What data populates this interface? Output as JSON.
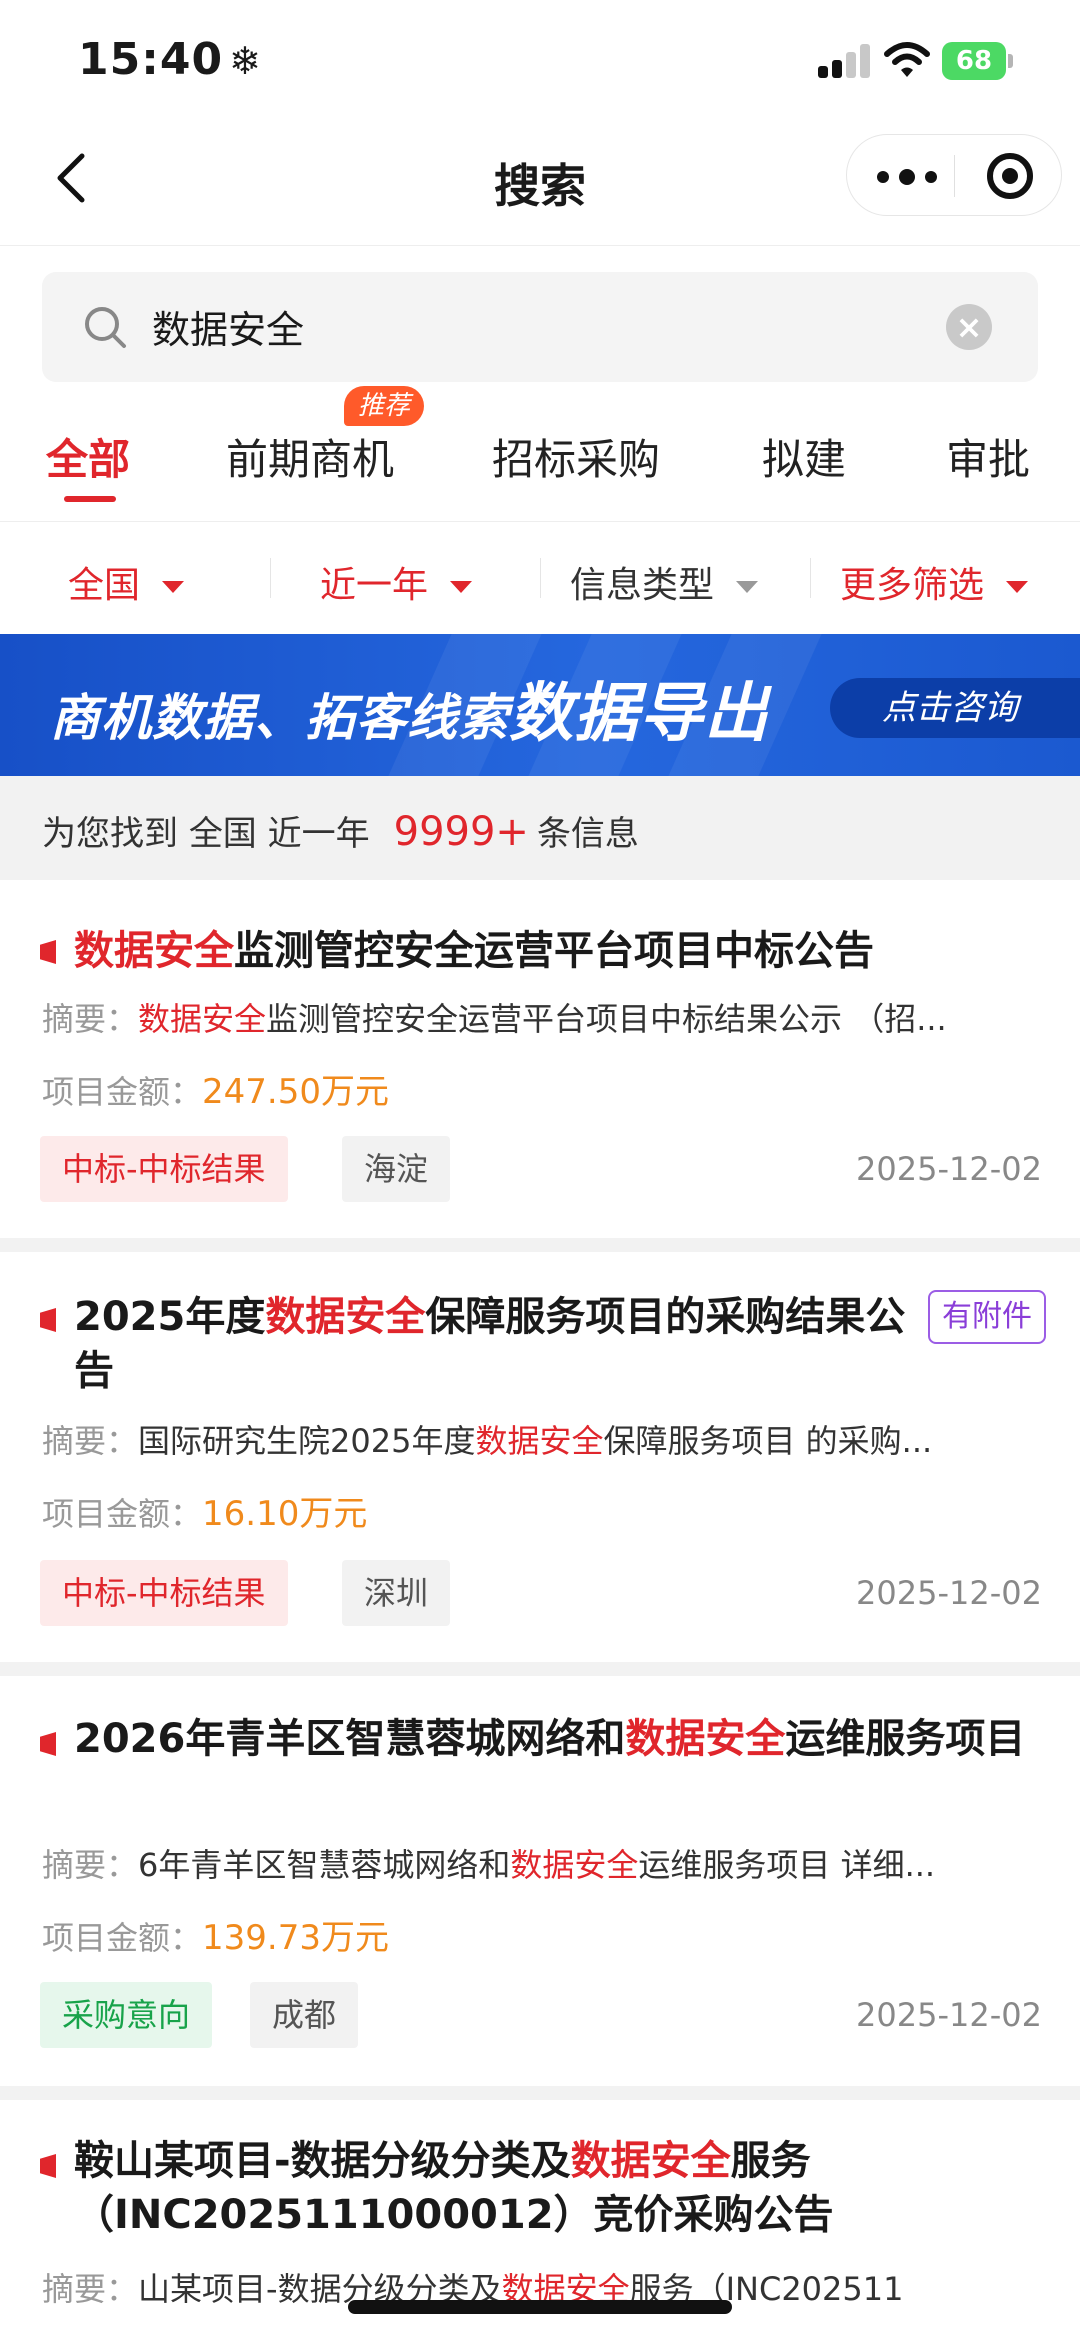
{
  "status_bar": {
    "time": "15:40",
    "weather_glyph": "❄",
    "battery": "68"
  },
  "nav": {
    "title": "搜索"
  },
  "search": {
    "value": "数据安全",
    "clear_glyph": "×"
  },
  "tabs": [
    {
      "label": "全部"
    },
    {
      "label": "前期商机",
      "badge": "推荐"
    },
    {
      "label": "招标采购"
    },
    {
      "label": "拟建"
    },
    {
      "label": "审批"
    }
  ],
  "filters": [
    {
      "label": "全国"
    },
    {
      "label": "近一年"
    },
    {
      "label": "信息类型"
    },
    {
      "label": "更多筛选"
    }
  ],
  "banner": {
    "text_small": "商机数据、拓客线索",
    "text_big": "数据导出",
    "button": "点击咨询"
  },
  "summary": {
    "prefix": "为您找到",
    "region": "全国",
    "period": "近一年",
    "count": "9999+",
    "suffix": "条信息"
  },
  "results": [
    {
      "title_pre": "",
      "title_hl": "数据安全",
      "title_post": "监测管控安全运营平台项目中标公告",
      "summary_label": "摘要：",
      "summary_pre": "",
      "summary_hl": "数据安全",
      "summary_post": "监测管控安全运营平台项目中标结果公示 （招...",
      "amount_label": "项目金额：",
      "amount": "247.50万元",
      "tag_type": "中标-中标结果",
      "tag_region": "海淀",
      "date": "2025-12-02"
    },
    {
      "title_pre": "2025年度",
      "title_hl": "数据安全",
      "title_post": "保障服务项目的采购结果公告",
      "attachment": "有附件",
      "summary_label": "摘要：",
      "summary_pre": "国际研究生院2025年度",
      "summary_hl": "数据安全",
      "summary_post": "保障服务项目 的采购...",
      "amount_label": "项目金额：",
      "amount": "16.10万元",
      "tag_type": "中标-中标结果",
      "tag_region": "深圳",
      "date": "2025-12-02"
    },
    {
      "title_pre": "2026年青羊区智慧蓉城网络和",
      "title_hl": "数据安全",
      "title_post": "运维服务项目",
      "summary_label": "摘要：",
      "summary_pre": "6年青羊区智慧蓉城网络和",
      "summary_hl": "数据安全",
      "summary_post": "运维服务项目 详细...",
      "amount_label": "项目金额：",
      "amount": "139.73万元",
      "tag_type": "采购意向",
      "tag_region": "成都",
      "date": "2025-12-02"
    },
    {
      "title_pre": "鞍山某项目-数据分级分类及",
      "title_hl": "数据安全",
      "title_post": "服务（INC2025111000012）竞价采购公告",
      "summary_label": "摘要：",
      "summary_pre": "山某项目-数据分级分类及",
      "summary_hl": "数据安全",
      "summary_post": "服务（INC202511"
    }
  ],
  "colors": {
    "accent": "#e0262c",
    "amount": "#f08a1c",
    "banner": "#1f5fd6",
    "attachment": "#8a3ed8"
  }
}
